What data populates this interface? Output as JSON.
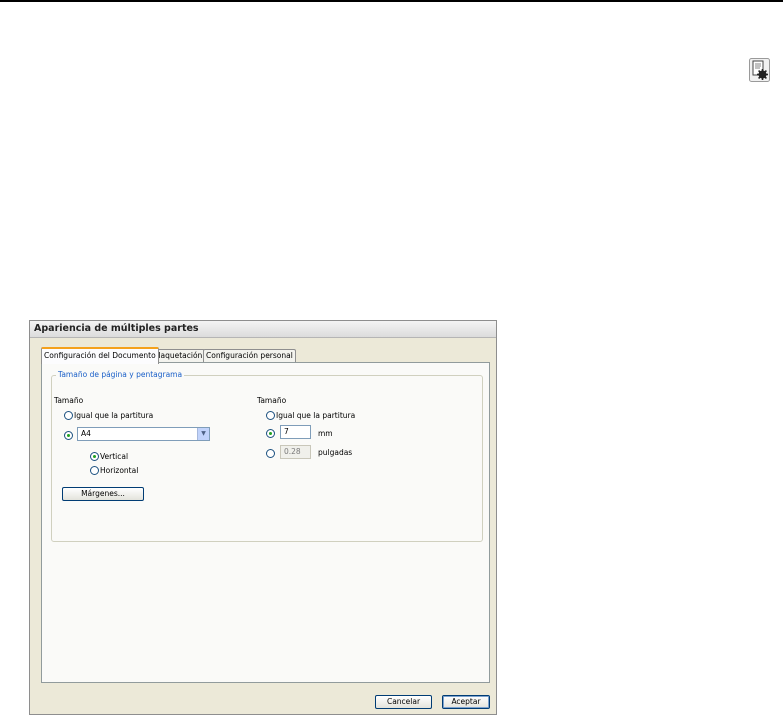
{
  "header": {
    "icon": "document-settings-icon"
  },
  "dialog": {
    "title": "Apariencia de múltiples partes",
    "tabs": [
      {
        "label": "Configuración del Documento",
        "active": true
      },
      {
        "label": "Maquetación",
        "active": false
      },
      {
        "label": "Configuración personal",
        "active": false
      }
    ],
    "group": {
      "legend": "Tamaño de página y pentagrama",
      "page_size": {
        "heading": "Tamaño",
        "same_as_score": "Igual que la partitura",
        "paper_select": "A4",
        "portrait": "Vertical",
        "landscape": "Horizontal",
        "margins_button": "Márgenes..."
      },
      "staff_size": {
        "heading": "Tamaño",
        "same_as_score": "Igual que la partitura",
        "mm_value": "7",
        "mm_unit": "mm",
        "inches_value": "0.28",
        "inches_unit": "pulgadas"
      }
    },
    "buttons": {
      "cancel": "Cancelar",
      "accept": "Aceptar"
    }
  },
  "colors": {
    "tab_accent": "#f4a11c",
    "legend_text": "#1a5fc8",
    "radio_dot": "#21a121"
  }
}
